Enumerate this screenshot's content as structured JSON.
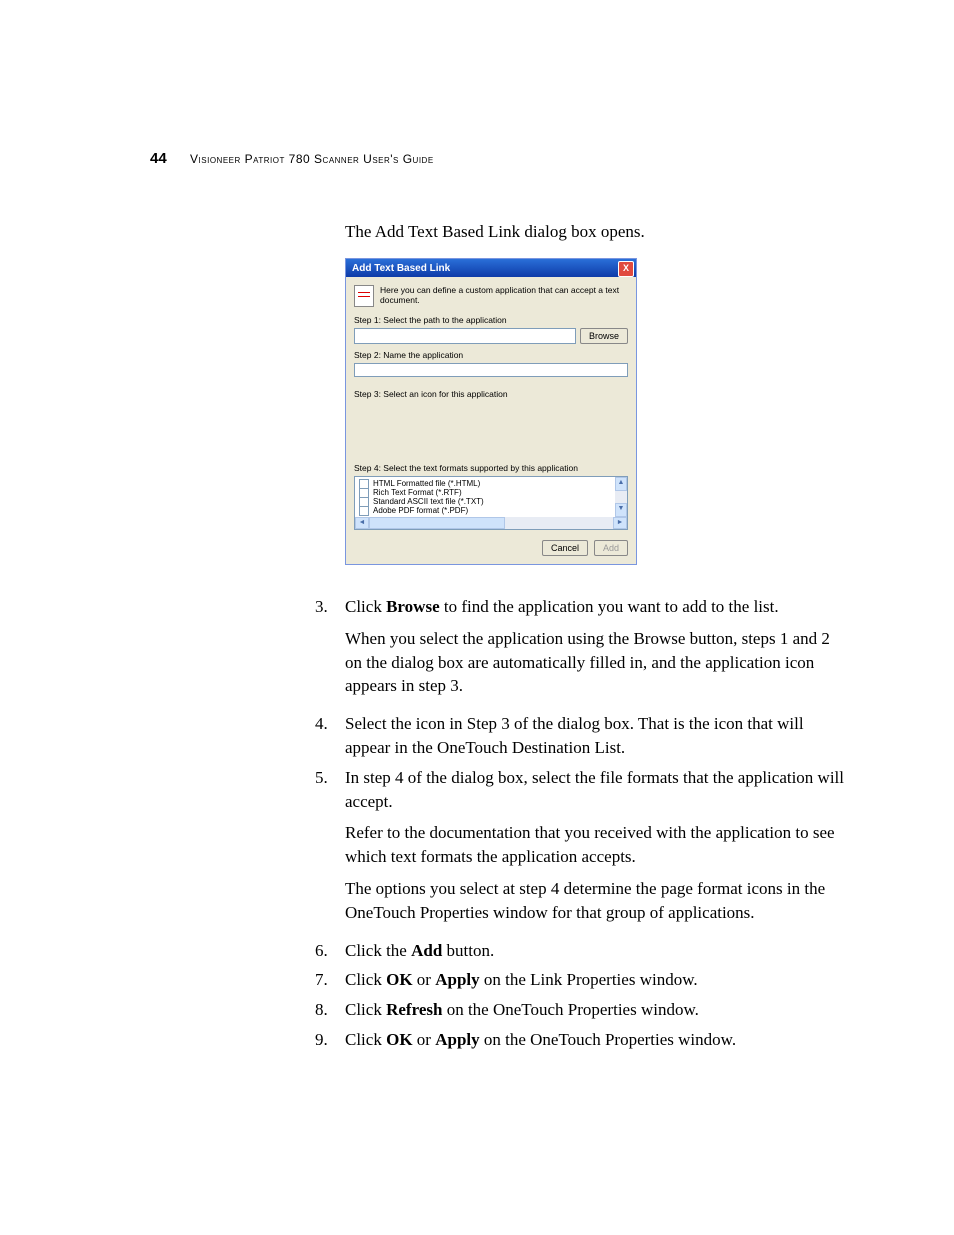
{
  "header": {
    "page_number": "44",
    "title": "Visioneer Patriot 780 Scanner User's Guide"
  },
  "intro": "The Add Text Based Link dialog box opens.",
  "dialog": {
    "title": "Add Text Based Link",
    "close_glyph": "X",
    "description": "Here you can define a custom application that can accept a text document.",
    "step1_label": "Step 1: Select the path to the application",
    "browse_btn": "Browse",
    "step2_label": "Step 2: Name the application",
    "step3_label": "Step 3: Select an icon for this application",
    "step4_label": "Step 4: Select the text formats supported by this application",
    "formats": [
      "HTML Formatted file (*.HTML)",
      "Rich Text Format (*.RTF)",
      "Standard ASCII text file (*.TXT)",
      "Adobe PDF format (*.PDF)"
    ],
    "cancel_btn": "Cancel",
    "add_btn": "Add"
  },
  "steps": [
    {
      "num": "3.",
      "parts": [
        {
          "type": "text",
          "value": "Click "
        },
        {
          "type": "bold",
          "value": "Browse"
        },
        {
          "type": "text",
          "value": " to find the application you want to add to the list."
        }
      ],
      "paras": [
        "When you select the application using the Browse button, steps 1 and 2 on the dialog box are automatically filled in, and the application icon appears in step 3."
      ]
    },
    {
      "num": "4.",
      "parts": [
        {
          "type": "text",
          "value": "Select the icon in Step 3 of the dialog box. That is the icon that will appear in the OneTouch Destination List."
        }
      ]
    },
    {
      "num": "5.",
      "parts": [
        {
          "type": "text",
          "value": "In step 4 of the dialog box, select the file formats that the application will accept."
        }
      ],
      "paras": [
        "Refer to the documentation that you received with the application to see which text formats the application accepts.",
        "The options you select at step 4 determine the page format icons in the OneTouch Properties window for that group of applications."
      ]
    },
    {
      "num": "6.",
      "parts": [
        {
          "type": "text",
          "value": "Click the "
        },
        {
          "type": "bold",
          "value": "Add"
        },
        {
          "type": "text",
          "value": " button."
        }
      ]
    },
    {
      "num": "7.",
      "parts": [
        {
          "type": "text",
          "value": "Click "
        },
        {
          "type": "bold",
          "value": "OK"
        },
        {
          "type": "text",
          "value": " or "
        },
        {
          "type": "bold",
          "value": "Apply"
        },
        {
          "type": "text",
          "value": " on the Link Properties window."
        }
      ]
    },
    {
      "num": "8.",
      "parts": [
        {
          "type": "text",
          "value": "Click "
        },
        {
          "type": "bold",
          "value": "Refresh"
        },
        {
          "type": "text",
          "value": " on the OneTouch Properties window."
        }
      ]
    },
    {
      "num": "9.",
      "parts": [
        {
          "type": "text",
          "value": "Click "
        },
        {
          "type": "bold",
          "value": "OK"
        },
        {
          "type": "text",
          "value": " or "
        },
        {
          "type": "bold",
          "value": "Apply"
        },
        {
          "type": "text",
          "value": " on the OneTouch Properties window."
        }
      ]
    }
  ]
}
